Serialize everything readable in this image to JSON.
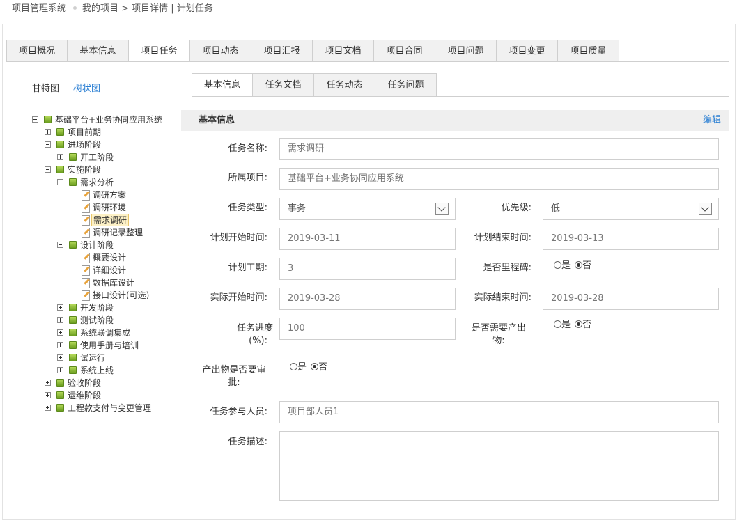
{
  "breadcrumb": {
    "system": "项目管理系统",
    "path": "我的项目 > 项目详情 | 计划任务"
  },
  "main_tabs": [
    "项目概况",
    "基本信息",
    "项目任务",
    "项目动态",
    "项目汇报",
    "项目文档",
    "项目合同",
    "项目问题",
    "项目变更",
    "项目质量"
  ],
  "main_tab_active": "项目任务",
  "view_switch": {
    "gantt": "甘特图",
    "tree": "树状图"
  },
  "sub_tabs": [
    "基本信息",
    "任务文档",
    "任务动态",
    "任务问题"
  ],
  "sub_tab_active": "基本信息",
  "tree": {
    "root": "基础平台+业务协同应用系统",
    "n1": "项目前期",
    "n2": "进场阶段",
    "n2_1": "开工阶段",
    "n3": "实施阶段",
    "n3_1": "需求分析",
    "n3_1_1": "调研方案",
    "n3_1_2": "调研环境",
    "n3_1_3": "需求调研",
    "n3_1_4": "调研记录整理",
    "n3_2": "设计阶段",
    "n3_2_1": "概要设计",
    "n3_2_2": "详细设计",
    "n3_2_3": "数据库设计",
    "n3_2_4": "接口设计(可选)",
    "n3_3": "开发阶段",
    "n3_4": "测试阶段",
    "n3_5": "系统联调集成",
    "n3_6": "使用手册与培训",
    "n3_7": "试运行",
    "n3_8": "系统上线",
    "n4": "验收阶段",
    "n5": "运维阶段",
    "n6": "工程款支付与变更管理"
  },
  "section": {
    "title": "基本信息",
    "edit": "编辑"
  },
  "form": {
    "task_name_label": "任务名称:",
    "task_name": "需求调研",
    "project_label": "所属项目:",
    "project": "基础平台+业务协同应用系统",
    "type_label": "任务类型:",
    "type": "事务",
    "priority_label": "优先级:",
    "priority": "低",
    "plan_start_label": "计划开始时间:",
    "plan_start": "2019-03-11",
    "plan_end_label": "计划结束时间:",
    "plan_end": "2019-03-13",
    "plan_days_label": "计划工期:",
    "plan_days": "3",
    "milestone_label": "是否里程碑:",
    "actual_start_label": "实际开始时间:",
    "actual_start": "2019-03-28",
    "actual_end_label": "实际结束时间:",
    "actual_end": "2019-03-28",
    "progress_label_1": "任务进度",
    "progress_label_2": "(%):",
    "progress": "100",
    "need_output_label_1": "是否需要产出",
    "need_output_label_2": "物:",
    "approve_label_1": "产出物是否要审",
    "approve_label_2": "批:",
    "members_label": "任务参与人员:",
    "members": "项目部人员1",
    "desc_label": "任务描述:",
    "yes": "是",
    "no": "否"
  }
}
